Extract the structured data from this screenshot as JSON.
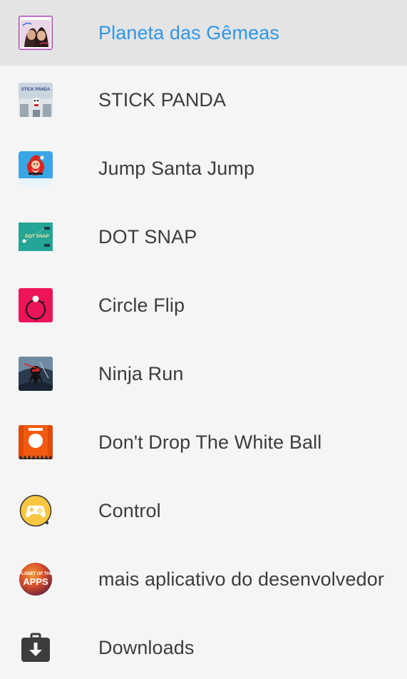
{
  "menu": {
    "items": [
      {
        "label": "Planeta das Gêmeas",
        "icon": "planeta-das-gemeas-app-icon",
        "selected": true
      },
      {
        "label": "STICK PANDA",
        "icon": "stick-panda-app-icon"
      },
      {
        "label": "Jump Santa Jump",
        "icon": "jump-santa-jump-app-icon"
      },
      {
        "label": "DOT SNAP",
        "icon": "dot-snap-app-icon"
      },
      {
        "label": "Circle Flip",
        "icon": "circle-flip-app-icon"
      },
      {
        "label": "Ninja Run",
        "icon": "ninja-run-app-icon"
      },
      {
        "label": "Don't Drop The White Ball",
        "icon": "dont-drop-white-ball-app-icon"
      },
      {
        "label": "Control",
        "icon": "control-gamepad-app-icon"
      },
      {
        "label": "mais aplicativo do desenvolvedor",
        "icon": "planet-of-apps-icon"
      },
      {
        "label": "Downloads",
        "icon": "downloads-briefcase-icon"
      }
    ]
  },
  "icon_texts": {
    "stick_panda": "STICK PANDA",
    "dot_snap": "DOT SNAP",
    "planet_of_apps_top": "PLANET OF THE",
    "planet_of_apps_main": "APPS"
  },
  "colors": {
    "selected_text": "#2e97e8",
    "item_text": "#3c3c3c",
    "selected_background": "#e4e4e4",
    "list_background": "#f5f5f5"
  }
}
